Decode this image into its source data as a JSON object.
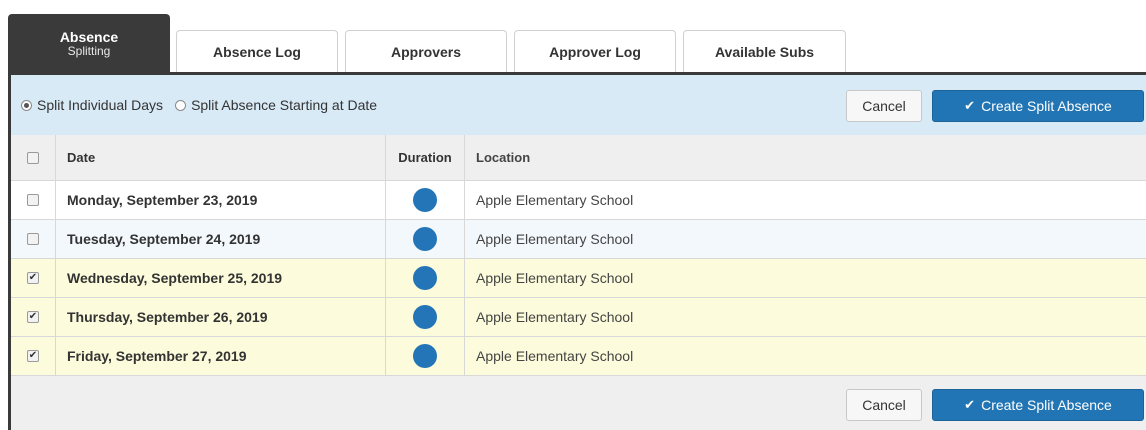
{
  "tabs": [
    {
      "label": "Absence",
      "sub": "Splitting",
      "active": true
    },
    {
      "label": "Absence Log"
    },
    {
      "label": "Approvers"
    },
    {
      "label": "Approver Log"
    },
    {
      "label": "Available Subs"
    }
  ],
  "toolbar": {
    "split_individual_label": "Split Individual Days",
    "split_starting_label": "Split Absence Starting at Date",
    "selected_option": "Split Individual Days",
    "cancel_label": "Cancel",
    "create_label": "Create Split Absence"
  },
  "table": {
    "headers": {
      "date": "Date",
      "duration": "Duration",
      "location": "Location"
    },
    "rows": [
      {
        "date": "Monday, September 23, 2019",
        "location": "Apple Elementary School",
        "checked": false
      },
      {
        "date": "Tuesday, September 24, 2019",
        "location": "Apple Elementary School",
        "checked": false
      },
      {
        "date": "Wednesday, September 25, 2019",
        "location": "Apple Elementary School",
        "checked": true
      },
      {
        "date": "Thursday, September 26, 2019",
        "location": "Apple Elementary School",
        "checked": true
      },
      {
        "date": "Friday, September 27, 2019",
        "location": "Apple Elementary School",
        "checked": true
      }
    ]
  },
  "footer": {
    "cancel_label": "Cancel",
    "create_label": "Create Split Absence"
  },
  "colors": {
    "primary": "#2275b4",
    "duration_dot": "#2475b7",
    "toolbar_bg": "#d9eaf7",
    "selected_row_bg": "#fcfbdb",
    "active_tab_bg": "#3a3a3a"
  }
}
